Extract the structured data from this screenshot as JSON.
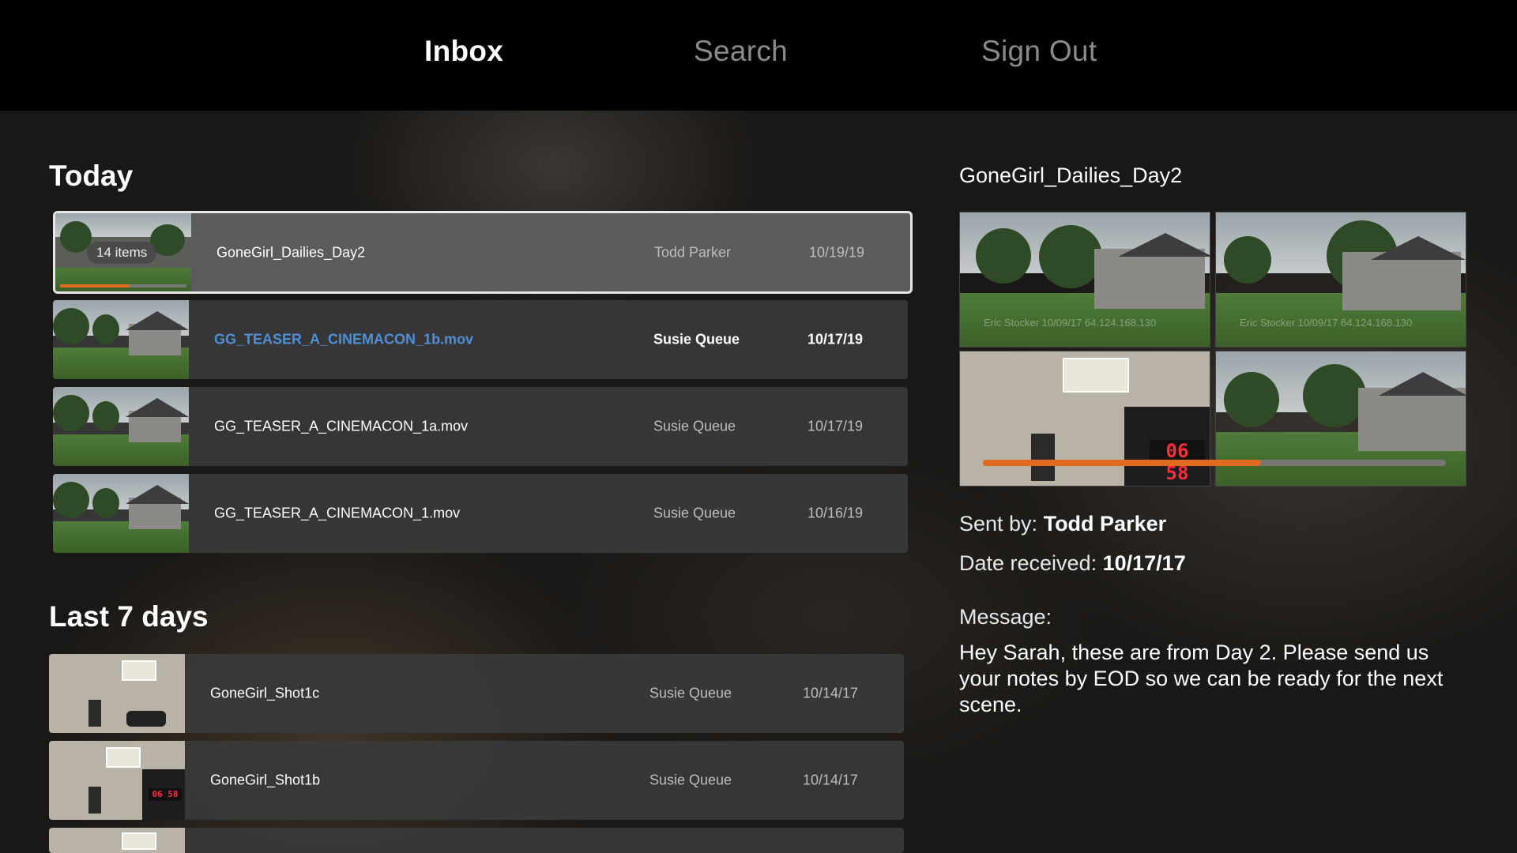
{
  "nav": {
    "items": [
      {
        "label": "Inbox",
        "active": true
      },
      {
        "label": "Search",
        "active": false
      },
      {
        "label": "Sign Out",
        "active": false
      }
    ]
  },
  "sections": {
    "today": "Today",
    "last7": "Last 7 days"
  },
  "today_rows": [
    {
      "name": "GoneGirl_Dailies_Day2",
      "sender": "Todd Parker",
      "date": "10/19/19",
      "badge": "14 items",
      "selected": true,
      "unread": false,
      "progress": 0.55
    },
    {
      "name": "GG_TEASER_A_CINEMACON_1b.mov",
      "sender": "Susie Queue",
      "date": "10/17/19",
      "unread": true
    },
    {
      "name": "GG_TEASER_A_CINEMACON_1a.mov",
      "sender": "Susie Queue",
      "date": "10/17/19",
      "unread": false
    },
    {
      "name": "GG_TEASER_A_CINEMACON_1.mov",
      "sender": "Susie Queue",
      "date": "10/16/19",
      "unread": false
    }
  ],
  "last7_rows": [
    {
      "name": "GoneGirl_Shot1c",
      "sender": "Susie Queue",
      "date": "10/14/17"
    },
    {
      "name": "GoneGirl_Shot1b",
      "sender": "Susie Queue",
      "date": "10/14/17"
    }
  ],
  "detail": {
    "title": "GoneGirl_Dailies_Day2",
    "sent_by_label": "Sent by:",
    "sent_by": "Todd Parker",
    "date_label": "Date received:",
    "date": "10/17/17",
    "message_label": "Message:",
    "message": "Hey Sarah, these are from Day 2. Please send us your notes by EOD so we can be ready for the next scene.",
    "watermark": "Eric Stocker 10/09/17 64.124.168.130",
    "slate_number": "06 58",
    "progress": 0.6
  },
  "colors": {
    "accent": "#e06a1f",
    "link": "#4e8fd6"
  }
}
